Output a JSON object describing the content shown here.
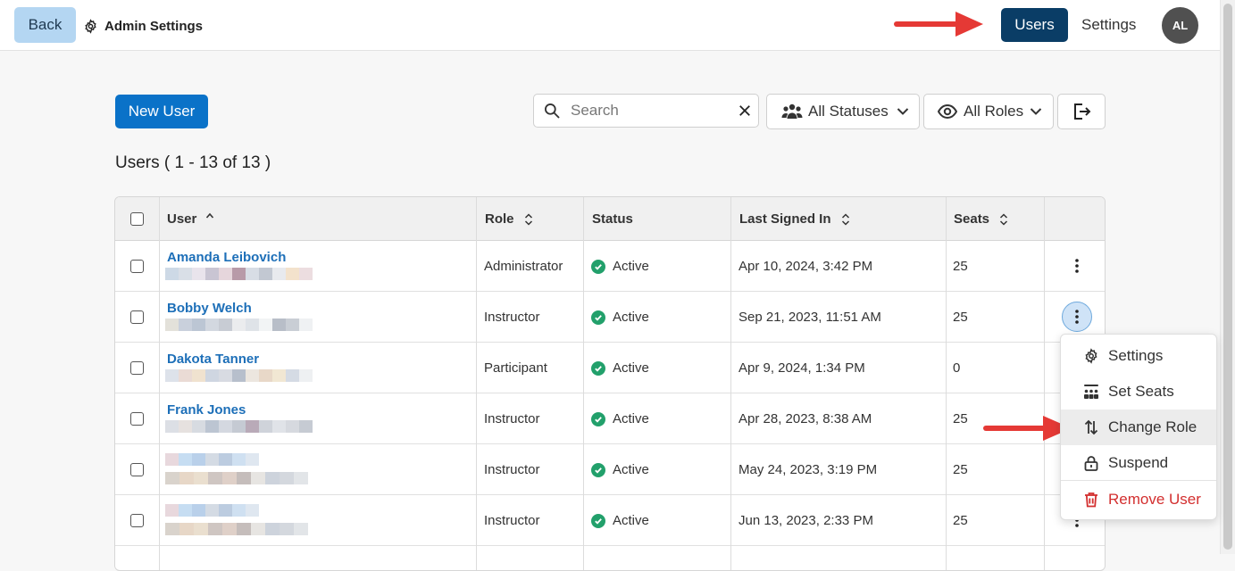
{
  "header": {
    "back_label": "Back",
    "admin_title": "Admin Settings",
    "users_label": "Users",
    "settings_label": "Settings",
    "avatar_initials": "AL"
  },
  "toolbar": {
    "new_user_label": "New User",
    "search_placeholder": "Search",
    "statuses_label": "All Statuses",
    "roles_label": "All Roles"
  },
  "users_count": "Users ( 1 - 13 of 13 )",
  "table": {
    "columns": [
      "User",
      "Role",
      "Status",
      "Last Signed In",
      "Seats"
    ],
    "rows": [
      {
        "name": "Amanda Leibovich",
        "role": "Administrator",
        "status": "Active",
        "last_signed_in": "Apr 10, 2024, 3:42 PM",
        "seats": "25"
      },
      {
        "name": "Bobby Welch",
        "role": "Instructor",
        "status": "Active",
        "last_signed_in": "Sep 21, 2023, 11:51 AM",
        "seats": "25"
      },
      {
        "name": "Dakota Tanner",
        "role": "Participant",
        "status": "Active",
        "last_signed_in": "Apr 9, 2024, 1:34 PM",
        "seats": "0"
      },
      {
        "name": "Frank Jones",
        "role": "Instructor",
        "status": "Active",
        "last_signed_in": "Apr 28, 2023, 8:38 AM",
        "seats": "25"
      },
      {
        "name": "",
        "role": "Instructor",
        "status": "Active",
        "last_signed_in": "May 24, 2023, 3:19 PM",
        "seats": "25"
      },
      {
        "name": "",
        "role": "Instructor",
        "status": "Active",
        "last_signed_in": "Jun 13, 2023, 2:33 PM",
        "seats": "25"
      }
    ]
  },
  "row_menu": {
    "items": [
      "Settings",
      "Set Seats",
      "Change Role",
      "Suspend",
      "Remove User"
    ]
  },
  "colors": {
    "primary": "#0a72c8",
    "nav_active": "#0a3d66",
    "active_status": "#22a06b",
    "danger": "#d32f2f",
    "annotation_arrow": "#e53935"
  }
}
